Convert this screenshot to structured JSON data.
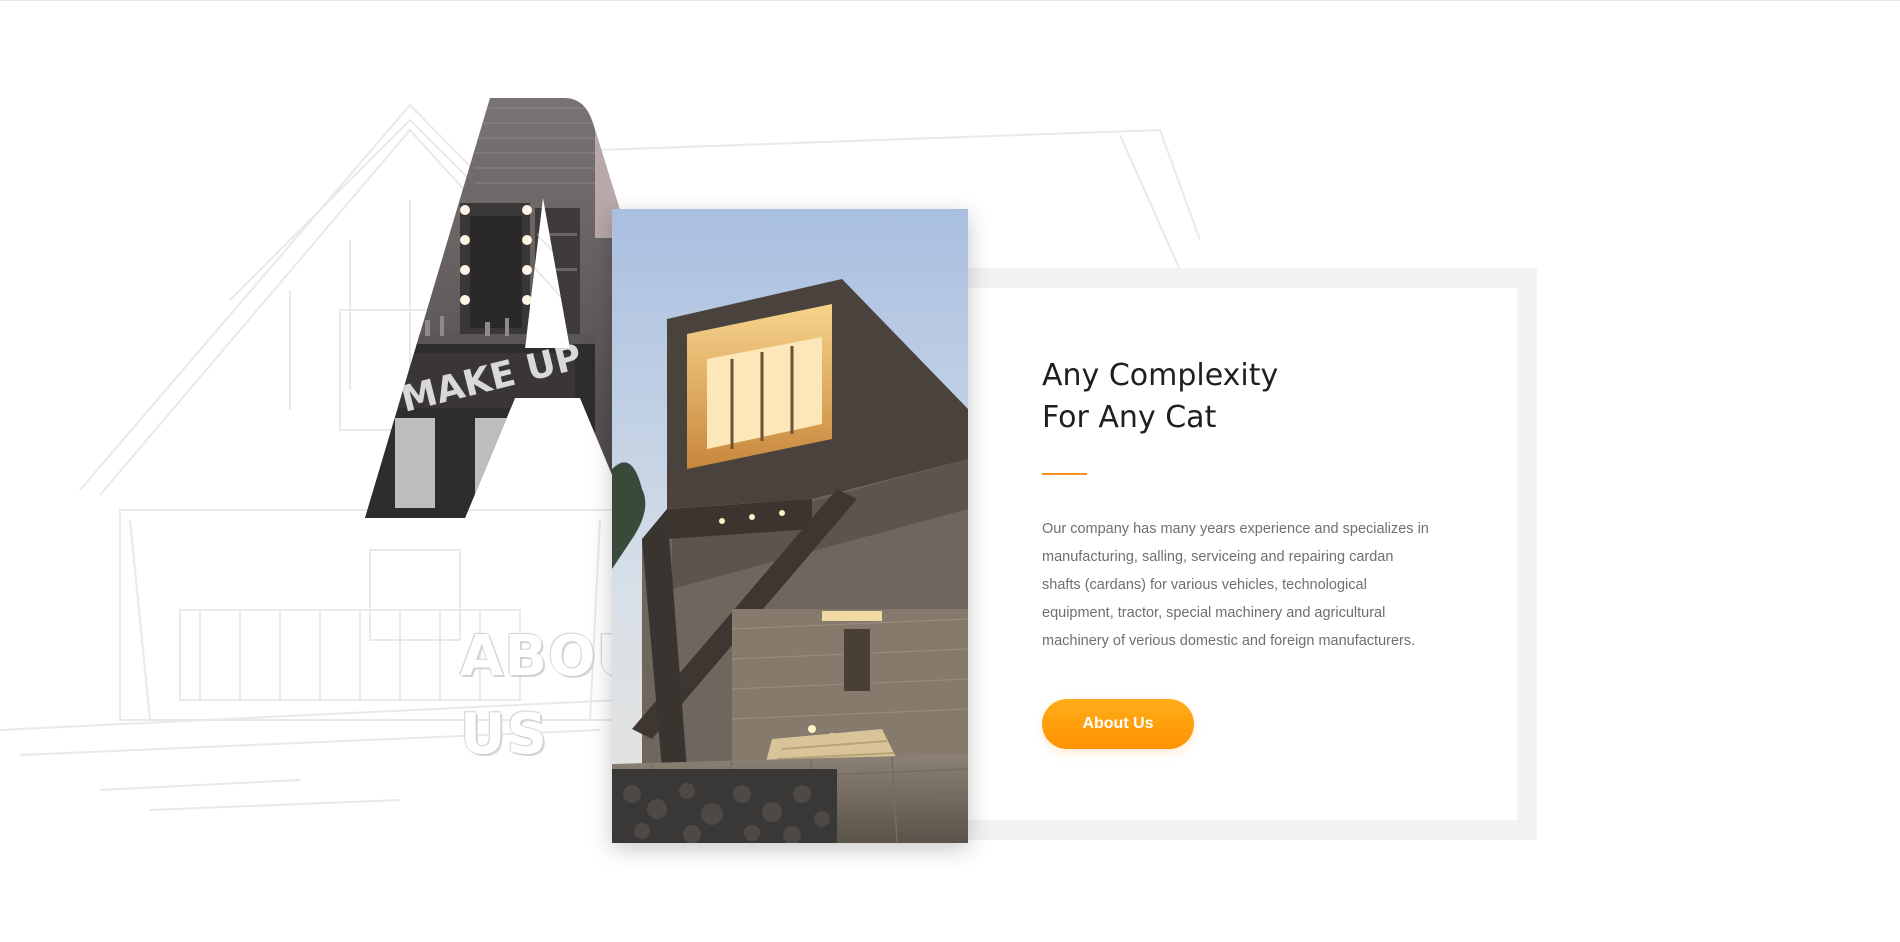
{
  "about": {
    "heading_line1": "ABOUT",
    "heading_line2": "US"
  },
  "card": {
    "title_line1": "Any Complexity",
    "title_line2": "For Any Cat",
    "description": "Our company has many years experience and specializes in manufacturing, salling, serviceing and repairing cardan shafts (cardans) for various vehicles, technological equipment, tractor, special machinery and agricultural machinery of verious domestic and foreign manufacturers.",
    "button_label": "About Us"
  },
  "letter_photo": {
    "sign_text": "MAKE UP"
  },
  "colors": {
    "accent": "#f5921e",
    "button": "#ff9f0f",
    "title": "#1f1f1f",
    "body_text": "#6f6f6f",
    "frame": "#f2f2f2"
  }
}
